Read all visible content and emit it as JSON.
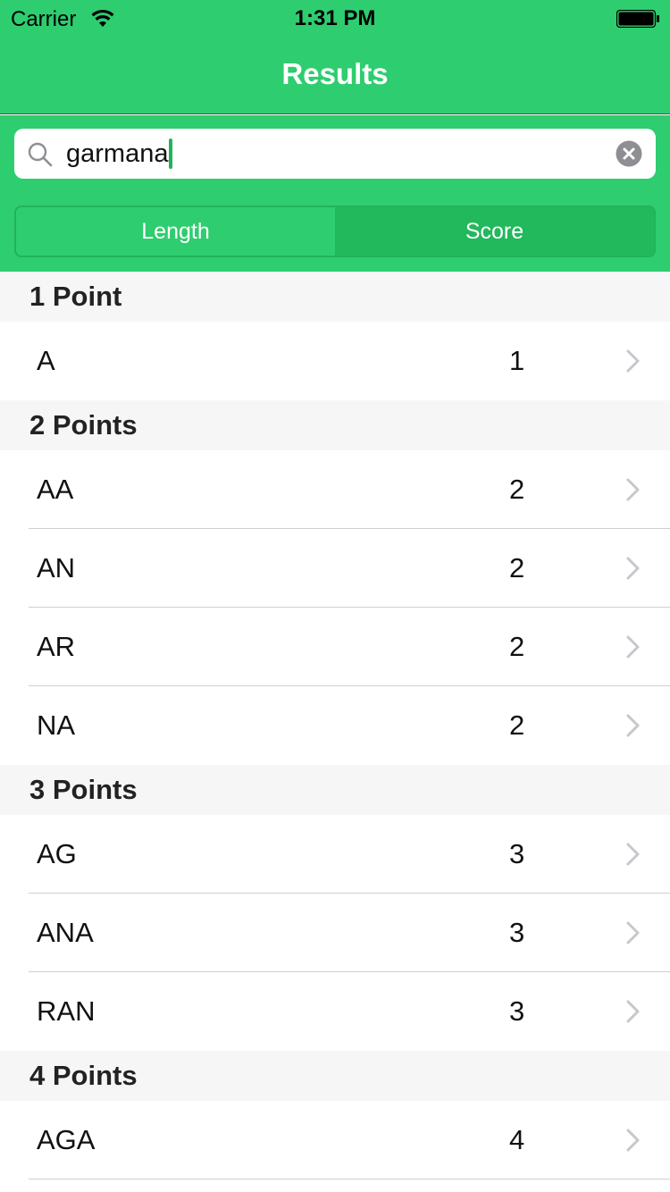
{
  "status_bar": {
    "carrier": "Carrier",
    "time": "1:31 PM"
  },
  "nav": {
    "title": "Results"
  },
  "search": {
    "value": "garmana"
  },
  "segments": [
    {
      "label": "Length",
      "selected": false
    },
    {
      "label": "Score",
      "selected": true
    }
  ],
  "sections": [
    {
      "header": "1 Point",
      "rows": [
        {
          "word": "A",
          "score": "1"
        }
      ]
    },
    {
      "header": "2 Points",
      "rows": [
        {
          "word": "AA",
          "score": "2"
        },
        {
          "word": "AN",
          "score": "2"
        },
        {
          "word": "AR",
          "score": "2"
        },
        {
          "word": "NA",
          "score": "2"
        }
      ]
    },
    {
      "header": "3 Points",
      "rows": [
        {
          "word": "AG",
          "score": "3"
        },
        {
          "word": "ANA",
          "score": "3"
        },
        {
          "word": "RAN",
          "score": "3"
        }
      ]
    },
    {
      "header": "4 Points",
      "rows": [
        {
          "word": "AGA",
          "score": "4"
        }
      ]
    }
  ],
  "colors": {
    "accent": "#2ecd6f",
    "segment_selected": "#22b85c",
    "section_header_bg": "#f6f6f6"
  },
  "icons": {
    "search": "search-icon",
    "clear": "clear-icon",
    "disclosure": "chevron-right-icon",
    "wifi": "wifi-icon",
    "battery": "battery-icon"
  }
}
